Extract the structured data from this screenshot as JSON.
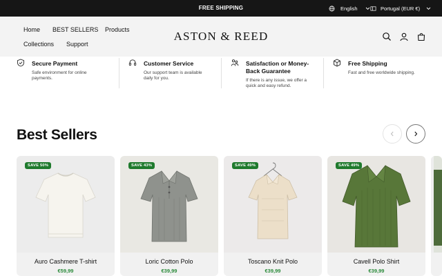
{
  "topbar": {
    "announcement": "FREE SHIPPING",
    "language": "English",
    "country": "Portugal (EUR €)"
  },
  "header": {
    "brand": "ASTON & REED",
    "nav": [
      "Home",
      "BEST SELLERS",
      "Products",
      "Collections",
      "Support"
    ]
  },
  "features": [
    {
      "title": "Secure Payment",
      "desc_lines": [
        "Safe environment for online",
        "payments."
      ],
      "icon": "shield-check-icon"
    },
    {
      "title": "Customer Service",
      "desc_lines": [
        "Our support team is available",
        "daily for you."
      ],
      "icon": "headset-icon"
    },
    {
      "title": "Satisfaction or Money-Back Guarantee",
      "title_lines": [
        "Satisfaction or Money-",
        "Back Guarantee"
      ],
      "desc_lines": [
        "If there is any issue, we offer a",
        "quick and easy refund."
      ],
      "icon": "handshake-icon"
    },
    {
      "title": "Free Shipping",
      "desc_lines": [
        "Fast and free worldwide shipping."
      ],
      "icon": "package-icon"
    }
  ],
  "section": {
    "title": "Best Sellers"
  },
  "products": [
    {
      "name": "Auro Cashmere T-shirt",
      "price": "€59,99",
      "badge": "SAVE 50%",
      "color": "#f4f2ec",
      "bg": "#ececec",
      "style": "tee"
    },
    {
      "name": "Loric Cotton Polo",
      "price": "€39,99",
      "badge": "SAVE 43%",
      "color": "#8e918c",
      "bg": "#e9e8e3",
      "style": "polo"
    },
    {
      "name": "Toscano Knit Polo",
      "price": "€39,99",
      "badge": "SAVE 49%",
      "color": "#ebe0cc",
      "bg": "#eceaea",
      "style": "knit"
    },
    {
      "name": "Cavell Polo Shirt",
      "price": "€39,99",
      "badge": "SAVE 49%",
      "color": "#587739",
      "bg": "#e8e6e2",
      "style": "cavell"
    }
  ],
  "colors": {
    "topbar": "#161616",
    "header": "#f3f3f3",
    "badge": "#1f7a2d",
    "price": "#2a8a3a"
  }
}
